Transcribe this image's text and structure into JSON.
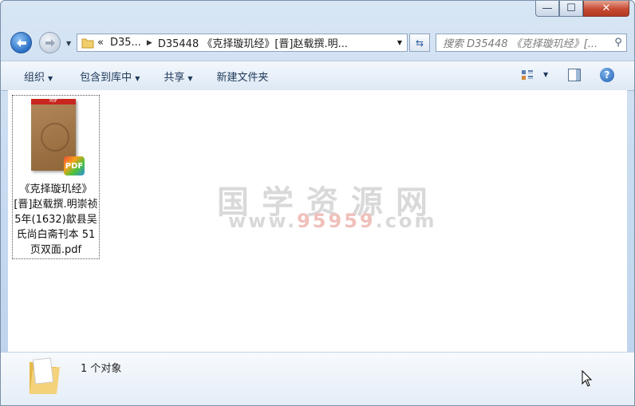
{
  "window": {
    "controls": {
      "minimize": "—",
      "maximize": "☐",
      "close": "✕"
    }
  },
  "nav": {
    "back_icon": "back-arrow-icon",
    "forward_icon": "forward-arrow-icon"
  },
  "address": {
    "overflow": "«",
    "segments": [
      "D35...",
      "D35448 《克择璇玑经》[晋]赵载撰.明..."
    ]
  },
  "search": {
    "placeholder": "搜索 D35448 《克择璇玑经》[..."
  },
  "toolbar": {
    "organize": "组织",
    "include_library": "包含到库中",
    "share": "共享",
    "new_folder": "新建文件夹"
  },
  "files": [
    {
      "name": "《克择璇玑经》[晋]赵载撰.明崇祯5年(1632)歙县吴氏尚白斋刊本 51页双面.pdf",
      "thumb_label": "PDF",
      "badge": "PDF"
    }
  ],
  "watermark": {
    "text": "国学资源网",
    "url_prefix": "www.",
    "url_number": "95959",
    "url_suffix": ".com"
  },
  "status": {
    "count_text": "1 个对象"
  },
  "colors": {
    "chrome": "#c9dcf0",
    "close_button": "#c64a31",
    "pdf_red": "#c8261f"
  }
}
